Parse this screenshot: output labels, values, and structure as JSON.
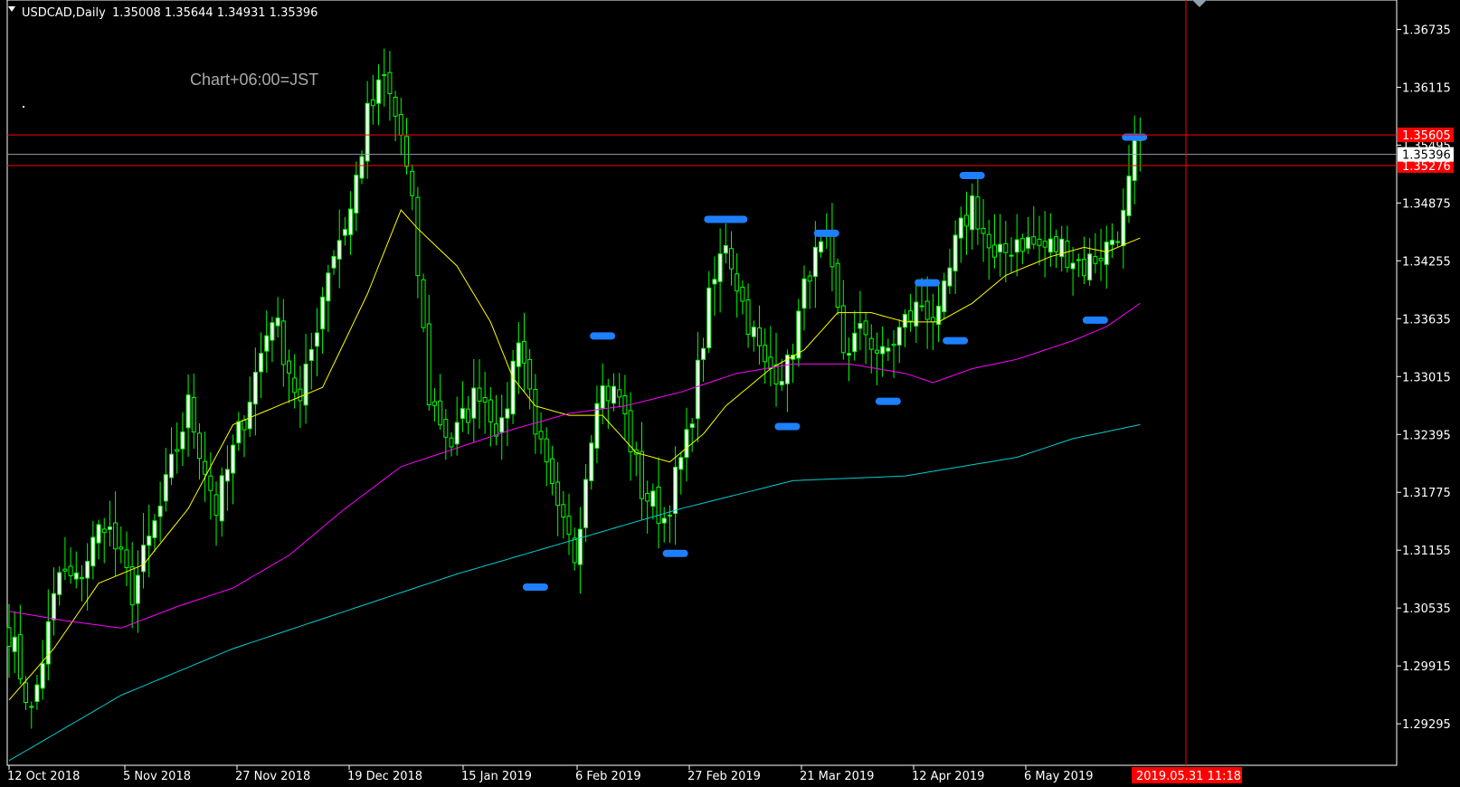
{
  "header": {
    "symbol": "USDCAD,Daily",
    "ohlc": "1.35008 1.35644 1.34931 1.35396"
  },
  "annotation_text": "Chart+06:00=JST",
  "colors": {
    "background": "#000000",
    "bull_body": "#ffffff",
    "bear_body": "#000000",
    "wick": "#00ff00",
    "ma_short": "#ffff00",
    "ma_mid": "#ff00ff",
    "ma_long": "#00ced1",
    "hline": "#ff0000",
    "price_line": "#8fa0b0",
    "marker": "#1e7fff",
    "axis": "#ffffff"
  },
  "chart_data": {
    "type": "candlestick",
    "ylim": [
      1.2885,
      1.3705
    ],
    "y_ticks": [
      "1.36735",
      "1.36115",
      "1.35495",
      "1.34875",
      "1.34255",
      "1.33635",
      "1.33015",
      "1.32395",
      "1.31775",
      "1.31155",
      "1.30535",
      "1.29915",
      "1.29295"
    ],
    "x_ticks": [
      "12 Oct 2018",
      "5 Nov 2018",
      "27 Nov 2018",
      "19 Dec 2018",
      "15 Jan 2019",
      "6 Feb 2019",
      "27 Feb 2019",
      "21 Mar 2019",
      "12 Apr 2019",
      "6 May 2019"
    ],
    "current_price": "1.35396",
    "hlines": [
      {
        "value": "1.35605"
      },
      {
        "value": "1.35276"
      }
    ],
    "crosshair_time": "2019.05.31 11:18",
    "anchors": [
      {
        "i": 0,
        "c": 1.303
      },
      {
        "i": 4,
        "c": 1.294
      },
      {
        "i": 9,
        "c": 1.309
      },
      {
        "i": 12,
        "c": 1.308
      },
      {
        "i": 17,
        "c": 1.315
      },
      {
        "i": 22,
        "c": 1.307
      },
      {
        "i": 27,
        "c": 1.316
      },
      {
        "i": 32,
        "c": 1.327
      },
      {
        "i": 37,
        "c": 1.316
      },
      {
        "i": 42,
        "c": 1.326
      },
      {
        "i": 47,
        "c": 1.337
      },
      {
        "i": 52,
        "c": 1.327
      },
      {
        "i": 57,
        "c": 1.342
      },
      {
        "i": 61,
        "c": 1.348
      },
      {
        "i": 64,
        "c": 1.358
      },
      {
        "i": 67,
        "c": 1.362
      },
      {
        "i": 70,
        "c": 1.356
      },
      {
        "i": 72,
        "c": 1.348
      },
      {
        "i": 75,
        "c": 1.328
      },
      {
        "i": 79,
        "c": 1.323
      },
      {
        "i": 84,
        "c": 1.329
      },
      {
        "i": 88,
        "c": 1.324
      },
      {
        "i": 91,
        "c": 1.335
      },
      {
        "i": 95,
        "c": 1.322
      },
      {
        "i": 98,
        "c": 1.315
      },
      {
        "i": 101,
        "c": 1.311
      },
      {
        "i": 105,
        "c": 1.329
      },
      {
        "i": 109,
        "c": 1.328
      },
      {
        "i": 113,
        "c": 1.318
      },
      {
        "i": 117,
        "c": 1.315
      },
      {
        "i": 121,
        "c": 1.323
      },
      {
        "i": 125,
        "c": 1.338
      },
      {
        "i": 128,
        "c": 1.345
      },
      {
        "i": 131,
        "c": 1.338
      },
      {
        "i": 135,
        "c": 1.331
      },
      {
        "i": 139,
        "c": 1.331
      },
      {
        "i": 143,
        "c": 1.342
      },
      {
        "i": 146,
        "c": 1.344
      },
      {
        "i": 149,
        "c": 1.333
      },
      {
        "i": 153,
        "c": 1.335
      },
      {
        "i": 156,
        "c": 1.332
      },
      {
        "i": 160,
        "c": 1.336
      },
      {
        "i": 163,
        "c": 1.338
      },
      {
        "i": 166,
        "c": 1.336
      },
      {
        "i": 169,
        "c": 1.344
      },
      {
        "i": 172,
        "c": 1.349
      },
      {
        "i": 176,
        "c": 1.342
      },
      {
        "i": 180,
        "c": 1.345
      },
      {
        "i": 184,
        "c": 1.344
      },
      {
        "i": 188,
        "c": 1.344
      },
      {
        "i": 192,
        "c": 1.342
      },
      {
        "i": 196,
        "c": 1.344
      },
      {
        "i": 199,
        "c": 1.347
      },
      {
        "i": 201,
        "c": 1.354
      },
      {
        "i": 202,
        "c": 1.354
      }
    ],
    "ma_short": [
      {
        "i": 0,
        "v": 1.2955
      },
      {
        "i": 8,
        "v": 1.301
      },
      {
        "i": 16,
        "v": 1.308
      },
      {
        "i": 24,
        "v": 1.31
      },
      {
        "i": 32,
        "v": 1.316
      },
      {
        "i": 40,
        "v": 1.325
      },
      {
        "i": 48,
        "v": 1.327
      },
      {
        "i": 56,
        "v": 1.329
      },
      {
        "i": 64,
        "v": 1.339
      },
      {
        "i": 70,
        "v": 1.348
      },
      {
        "i": 73,
        "v": 1.346
      },
      {
        "i": 80,
        "v": 1.342
      },
      {
        "i": 86,
        "v": 1.336
      },
      {
        "i": 90,
        "v": 1.33
      },
      {
        "i": 94,
        "v": 1.327
      },
      {
        "i": 100,
        "v": 1.326
      },
      {
        "i": 106,
        "v": 1.326
      },
      {
        "i": 112,
        "v": 1.322
      },
      {
        "i": 118,
        "v": 1.321
      },
      {
        "i": 124,
        "v": 1.324
      },
      {
        "i": 128,
        "v": 1.327
      },
      {
        "i": 132,
        "v": 1.329
      },
      {
        "i": 136,
        "v": 1.331
      },
      {
        "i": 142,
        "v": 1.333
      },
      {
        "i": 148,
        "v": 1.337
      },
      {
        "i": 154,
        "v": 1.337
      },
      {
        "i": 160,
        "v": 1.336
      },
      {
        "i": 166,
        "v": 1.336
      },
      {
        "i": 172,
        "v": 1.338
      },
      {
        "i": 178,
        "v": 1.341
      },
      {
        "i": 186,
        "v": 1.343
      },
      {
        "i": 192,
        "v": 1.344
      },
      {
        "i": 196,
        "v": 1.3435
      },
      {
        "i": 200,
        "v": 1.3445
      },
      {
        "i": 202,
        "v": 1.345
      }
    ],
    "ma_mid": [
      {
        "i": 0,
        "v": 1.305
      },
      {
        "i": 10,
        "v": 1.304
      },
      {
        "i": 20,
        "v": 1.3032
      },
      {
        "i": 30,
        "v": 1.3055
      },
      {
        "i": 40,
        "v": 1.3075
      },
      {
        "i": 50,
        "v": 1.311
      },
      {
        "i": 60,
        "v": 1.316
      },
      {
        "i": 70,
        "v": 1.3205
      },
      {
        "i": 80,
        "v": 1.3225
      },
      {
        "i": 90,
        "v": 1.3245
      },
      {
        "i": 100,
        "v": 1.3262
      },
      {
        "i": 110,
        "v": 1.327
      },
      {
        "i": 120,
        "v": 1.3285
      },
      {
        "i": 130,
        "v": 1.3305
      },
      {
        "i": 140,
        "v": 1.3315
      },
      {
        "i": 150,
        "v": 1.3315
      },
      {
        "i": 160,
        "v": 1.3305
      },
      {
        "i": 165,
        "v": 1.3295
      },
      {
        "i": 172,
        "v": 1.331
      },
      {
        "i": 180,
        "v": 1.332
      },
      {
        "i": 190,
        "v": 1.334
      },
      {
        "i": 196,
        "v": 1.3355
      },
      {
        "i": 202,
        "v": 1.338
      }
    ],
    "ma_long": [
      {
        "i": 0,
        "v": 1.289
      },
      {
        "i": 20,
        "v": 1.296
      },
      {
        "i": 40,
        "v": 1.301
      },
      {
        "i": 60,
        "v": 1.305
      },
      {
        "i": 80,
        "v": 1.309
      },
      {
        "i": 100,
        "v": 1.3125
      },
      {
        "i": 120,
        "v": 1.316
      },
      {
        "i": 140,
        "v": 1.319
      },
      {
        "i": 160,
        "v": 1.3195
      },
      {
        "i": 170,
        "v": 1.3205
      },
      {
        "i": 180,
        "v": 1.3215
      },
      {
        "i": 190,
        "v": 1.3235
      },
      {
        "i": 202,
        "v": 1.325
      }
    ]
  }
}
